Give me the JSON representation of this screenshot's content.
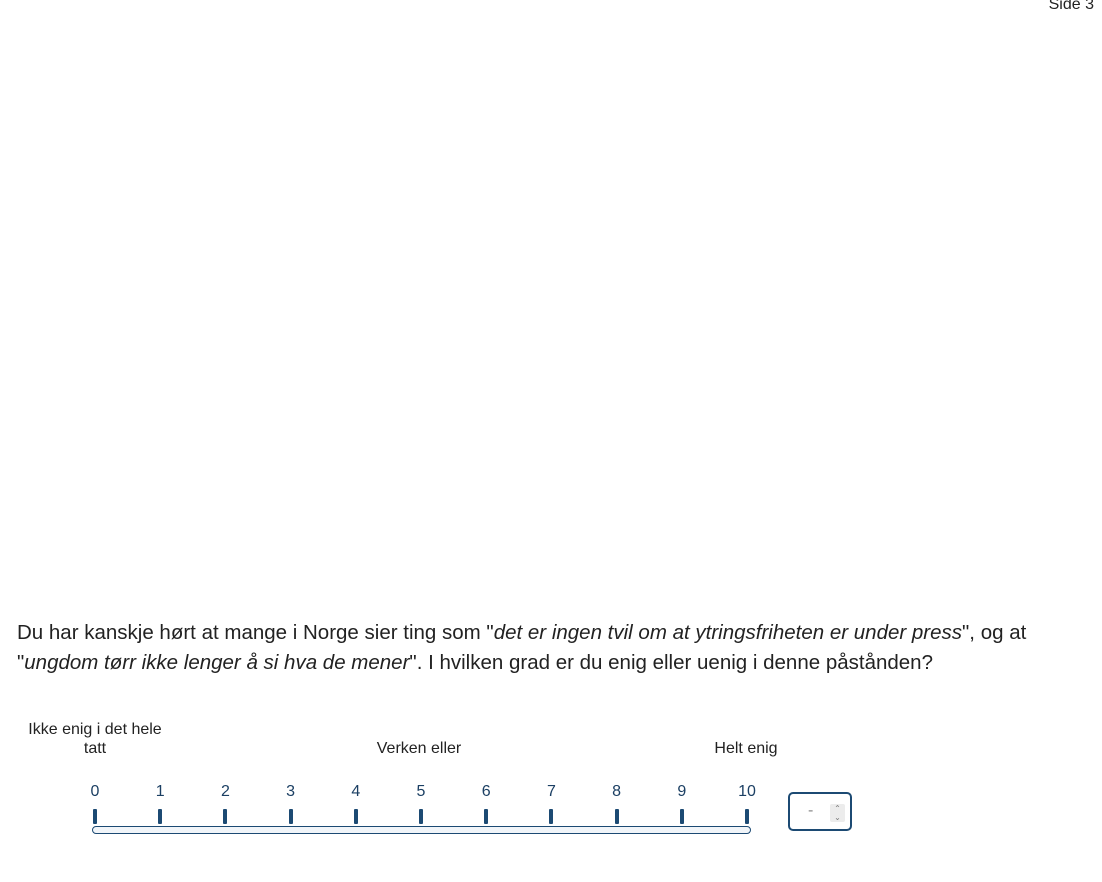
{
  "page_indicator": "Side 3",
  "question": {
    "part1": "Du har kanskje hørt at mange i Norge sier ting som \"",
    "quote1": "det er ingen tvil om at ytringsfriheten er under press",
    "part2": "\", og at \"",
    "quote2": "ungdom tørr ikke lenger å si hva de mener",
    "part3": "\". I hvilken grad er du enig eller uenig i denne påstånden?"
  },
  "scale": {
    "anchor_left": "Ikke enig i det hele tatt",
    "anchor_mid": "Verken eller",
    "anchor_right": "Helt enig",
    "ticks": [
      "0",
      "1",
      "2",
      "3",
      "4",
      "5",
      "6",
      "7",
      "8",
      "9",
      "10"
    ]
  },
  "number_input": {
    "value": "-",
    "up_icon": "chevron-up-icon",
    "down_icon": "chevron-down-icon"
  },
  "colors": {
    "accent": "#1c4a73",
    "tick_label": "#1b3f63"
  }
}
